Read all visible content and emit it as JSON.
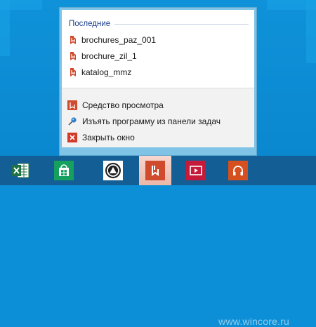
{
  "jumplist": {
    "recent_title": "Последние",
    "recent_items": [
      {
        "label": "brochures_paz_001",
        "icon": "pdf-reader-icon"
      },
      {
        "label": "brochure_zil_1",
        "icon": "pdf-reader-icon"
      },
      {
        "label": "katalog_mmz",
        "icon": "pdf-reader-icon"
      }
    ],
    "tasks": [
      {
        "label": "Средство просмотра",
        "icon": "reader-app-icon"
      },
      {
        "label": "Изъять программу из панели задач",
        "icon": "unpin-icon"
      },
      {
        "label": "Закрыть окно",
        "icon": "close-icon"
      }
    ]
  },
  "taskbar": {
    "apps": [
      {
        "name": "Excel",
        "icon": "excel-icon",
        "color": "#1f7246"
      },
      {
        "name": "Store",
        "icon": "store-icon",
        "color": "#16a05f"
      },
      {
        "name": "App",
        "icon": "app-icon",
        "color": "#1f1f1f"
      },
      {
        "name": "Reader",
        "icon": "pdf-reader-icon",
        "color": "#d04a2d",
        "active": true
      },
      {
        "name": "Video",
        "icon": "video-icon",
        "color": "#c61a3a"
      },
      {
        "name": "Music",
        "icon": "music-icon",
        "color": "#d64f1e"
      }
    ]
  },
  "watermark": "www.wincore.ru"
}
